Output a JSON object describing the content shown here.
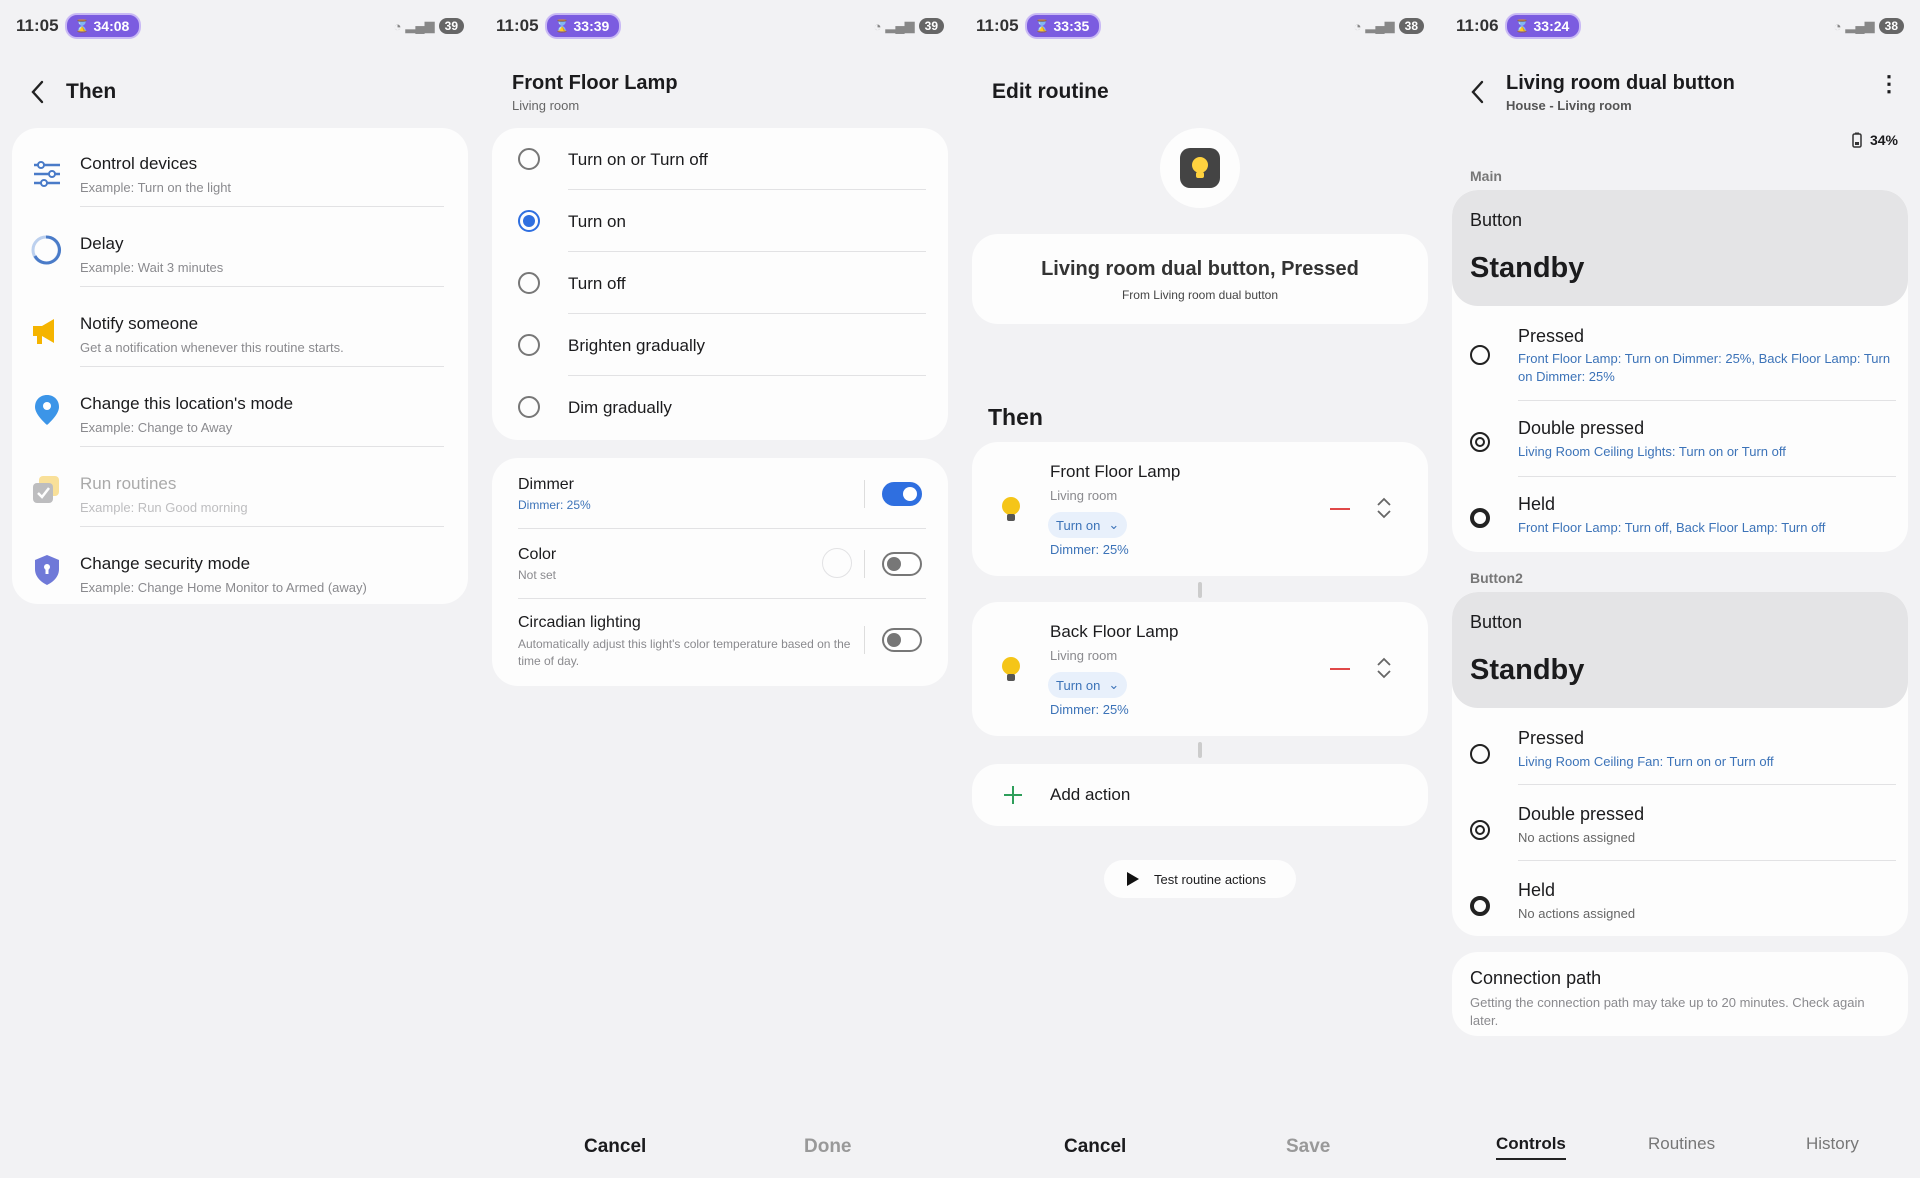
{
  "panels": [
    {
      "status": {
        "time": "11:05",
        "timer": "34:08",
        "battery": "39"
      },
      "header": {
        "title": "Then"
      },
      "items": [
        {
          "title": "Control devices",
          "subtitle": "Example: Turn on the light"
        },
        {
          "title": "Delay",
          "subtitle": "Example: Wait 3 minutes"
        },
        {
          "title": "Notify someone",
          "subtitle": "Get a notification whenever this routine starts."
        },
        {
          "title": "Change this location's mode",
          "subtitle": "Example: Change to Away"
        },
        {
          "title": "Run routines",
          "subtitle": "Example: Run Good morning"
        },
        {
          "title": "Change security mode",
          "subtitle": "Example: Change Home Monitor to Armed (away)"
        }
      ]
    },
    {
      "status": {
        "time": "11:05",
        "timer": "33:39",
        "battery": "39"
      },
      "header": {
        "title": "Front Floor Lamp",
        "subtitle": "Living room"
      },
      "options": [
        "Turn on or Turn off",
        "Turn on",
        "Turn off",
        "Brighten gradually",
        "Dim gradually"
      ],
      "settings": [
        {
          "title": "Dimmer",
          "subtitle": "Dimmer: 25%"
        },
        {
          "title": "Color",
          "subtitle": "Not set"
        },
        {
          "title": "Circadian lighting",
          "subtitle": "Automatically adjust this light's color temperature based on the time of day."
        }
      ],
      "footer": {
        "cancel": "Cancel",
        "done": "Done"
      }
    },
    {
      "status": {
        "time": "11:05",
        "timer": "33:35",
        "battery": "38"
      },
      "header": {
        "title": "Edit routine"
      },
      "trigger": {
        "title": "Living room dual button, Pressed",
        "subtitle": "From Living room dual button"
      },
      "then_label": "Then",
      "actions": [
        {
          "name": "Front Floor Lamp",
          "room": "Living room",
          "action": "Turn on",
          "detail": "Dimmer: 25%"
        },
        {
          "name": "Back Floor Lamp",
          "room": "Living room",
          "action": "Turn on",
          "detail": "Dimmer: 25%"
        }
      ],
      "add_action": "Add action",
      "test": "Test routine actions",
      "footer": {
        "cancel": "Cancel",
        "save": "Save"
      }
    },
    {
      "status": {
        "time": "11:06",
        "timer": "33:24",
        "battery": "38"
      },
      "header": {
        "title": "Living room dual button",
        "subtitle": "House - Living room"
      },
      "device_battery": "34%",
      "main_label": "Main",
      "main": {
        "button_label": "Button",
        "state": "Standby",
        "entries": [
          {
            "title": "Pressed",
            "detail": "Front Floor Lamp: Turn on Dimmer: 25%, Back Floor Lamp: Turn on Dimmer: 25%"
          },
          {
            "title": "Double pressed",
            "detail": "Living Room Ceiling Lights: Turn on or Turn off"
          },
          {
            "title": "Held",
            "detail": "Front Floor Lamp: Turn off, Back Floor Lamp: Turn off"
          }
        ]
      },
      "button2_label": "Button2",
      "button2": {
        "button_label": "Button",
        "state": "Standby",
        "entries": [
          {
            "title": "Pressed",
            "detail": "Living Room Ceiling Fan: Turn on or Turn off"
          },
          {
            "title": "Double pressed",
            "detail": "No actions assigned"
          },
          {
            "title": "Held",
            "detail": "No actions assigned"
          }
        ]
      },
      "connection": {
        "title": "Connection path",
        "subtitle": "Getting the connection path may take up to 20 minutes. Check again later."
      },
      "tabs": [
        "Controls",
        "Routines",
        "History"
      ]
    }
  ]
}
